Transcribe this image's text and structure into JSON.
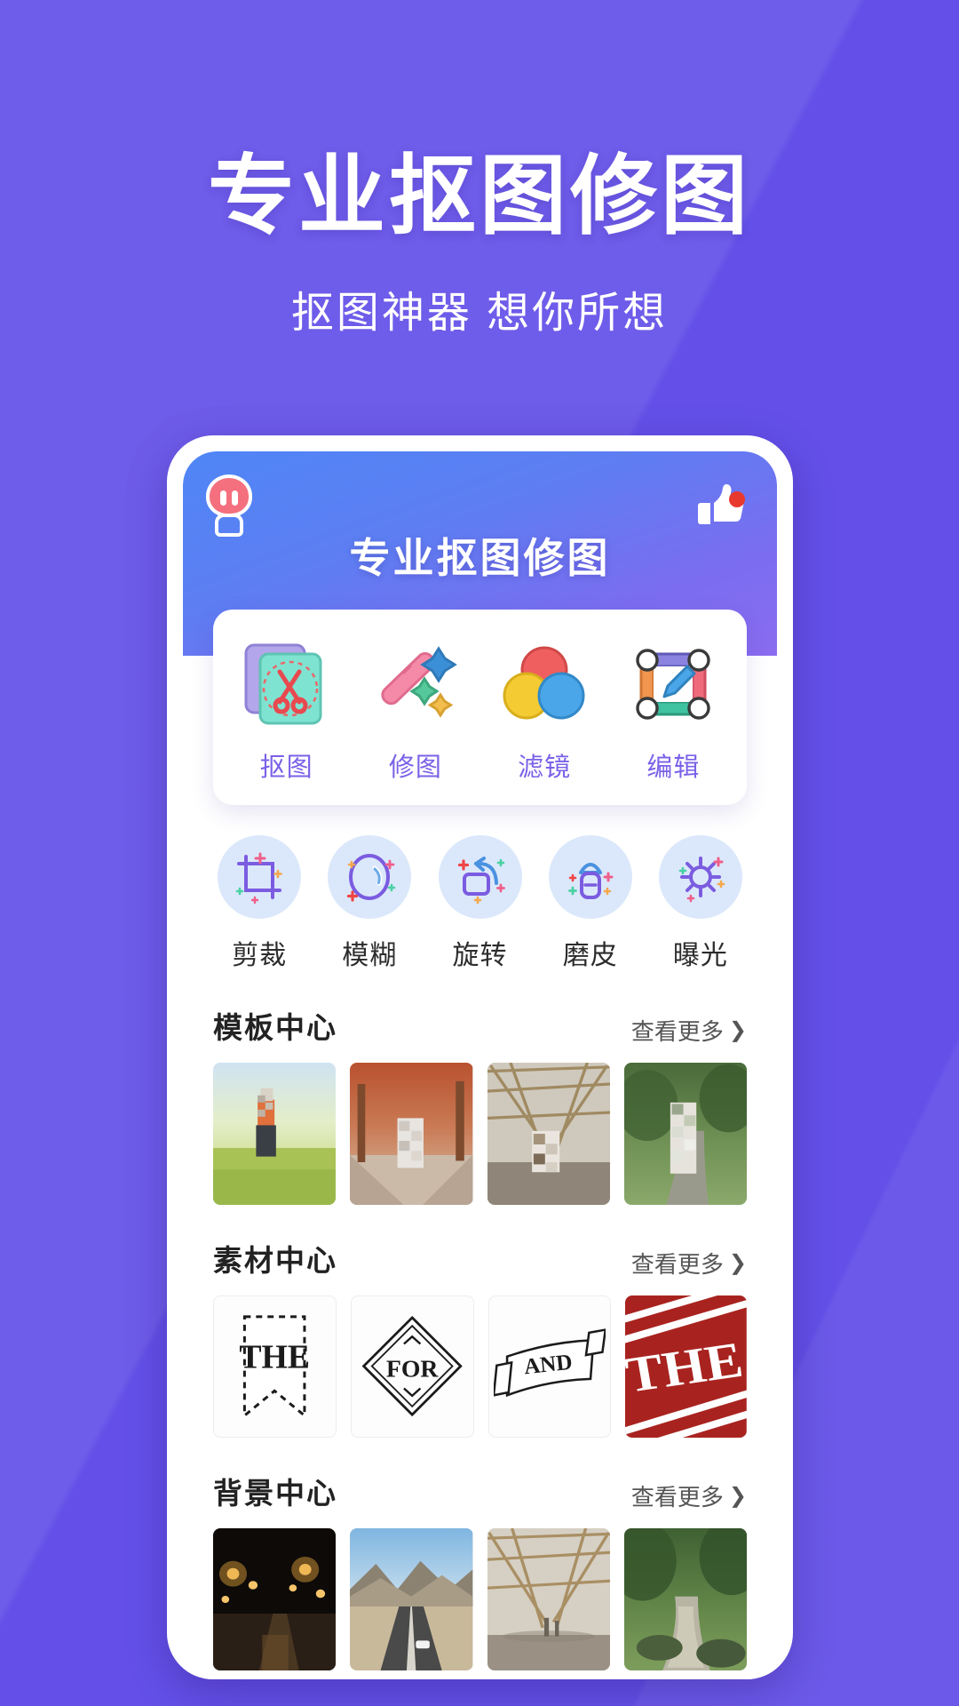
{
  "hero": {
    "title": "专业抠图修图",
    "subtitle": "抠图神器  想你所想"
  },
  "colors": {
    "background": "#6450e8",
    "app_header_from": "#4f86f7",
    "app_header_to": "#8a6cf0",
    "accent_label": "#7b61e8",
    "tool_bubble": "#dbe8fb",
    "badge_red": "#e8392f"
  },
  "app": {
    "title": "专业抠图修图",
    "robot_icon": "robot-mascot-icon",
    "like_icon": "thumbs-up-icon",
    "like_badge": "notification-dot"
  },
  "features": [
    {
      "label": "抠图",
      "icon": "cutout-scissors-icon"
    },
    {
      "label": "修图",
      "icon": "magic-wand-icon"
    },
    {
      "label": "滤镜",
      "icon": "color-circles-filter-icon"
    },
    {
      "label": "编辑",
      "icon": "edit-frame-pencil-icon"
    }
  ],
  "tools": [
    {
      "label": "剪裁",
      "icon": "crop-icon"
    },
    {
      "label": "模糊",
      "icon": "blur-icon"
    },
    {
      "label": "旋转",
      "icon": "rotate-icon"
    },
    {
      "label": "磨皮",
      "icon": "skin-smooth-brush-icon"
    },
    {
      "label": "曝光",
      "icon": "exposure-sun-icon"
    }
  ],
  "sections": [
    {
      "title": "模板中心",
      "more_label": "查看更多",
      "more_icon": "chevron-right-icon",
      "thumbs": [
        {
          "name": "template-wheat-field-portrait"
        },
        {
          "name": "template-autumn-street-portrait"
        },
        {
          "name": "template-wooden-pavilion-portrait"
        },
        {
          "name": "template-forest-path-portrait"
        }
      ]
    },
    {
      "title": "素材中心",
      "more_label": "查看更多",
      "more_icon": "chevron-right-icon",
      "thumbs": [
        {
          "name": "material-the-banner",
          "text": "THE"
        },
        {
          "name": "material-for-diamond",
          "text": "FOR"
        },
        {
          "name": "material-and-ribbon",
          "text": "AND"
        },
        {
          "name": "material-the-red-badge",
          "text": "THE"
        }
      ]
    },
    {
      "title": "背景中心",
      "more_label": "查看更多",
      "more_icon": "chevron-right-icon",
      "thumbs": [
        {
          "name": "background-night-street"
        },
        {
          "name": "background-desert-highway"
        },
        {
          "name": "background-wooden-pavilion"
        },
        {
          "name": "background-forest-stream"
        }
      ]
    }
  ]
}
